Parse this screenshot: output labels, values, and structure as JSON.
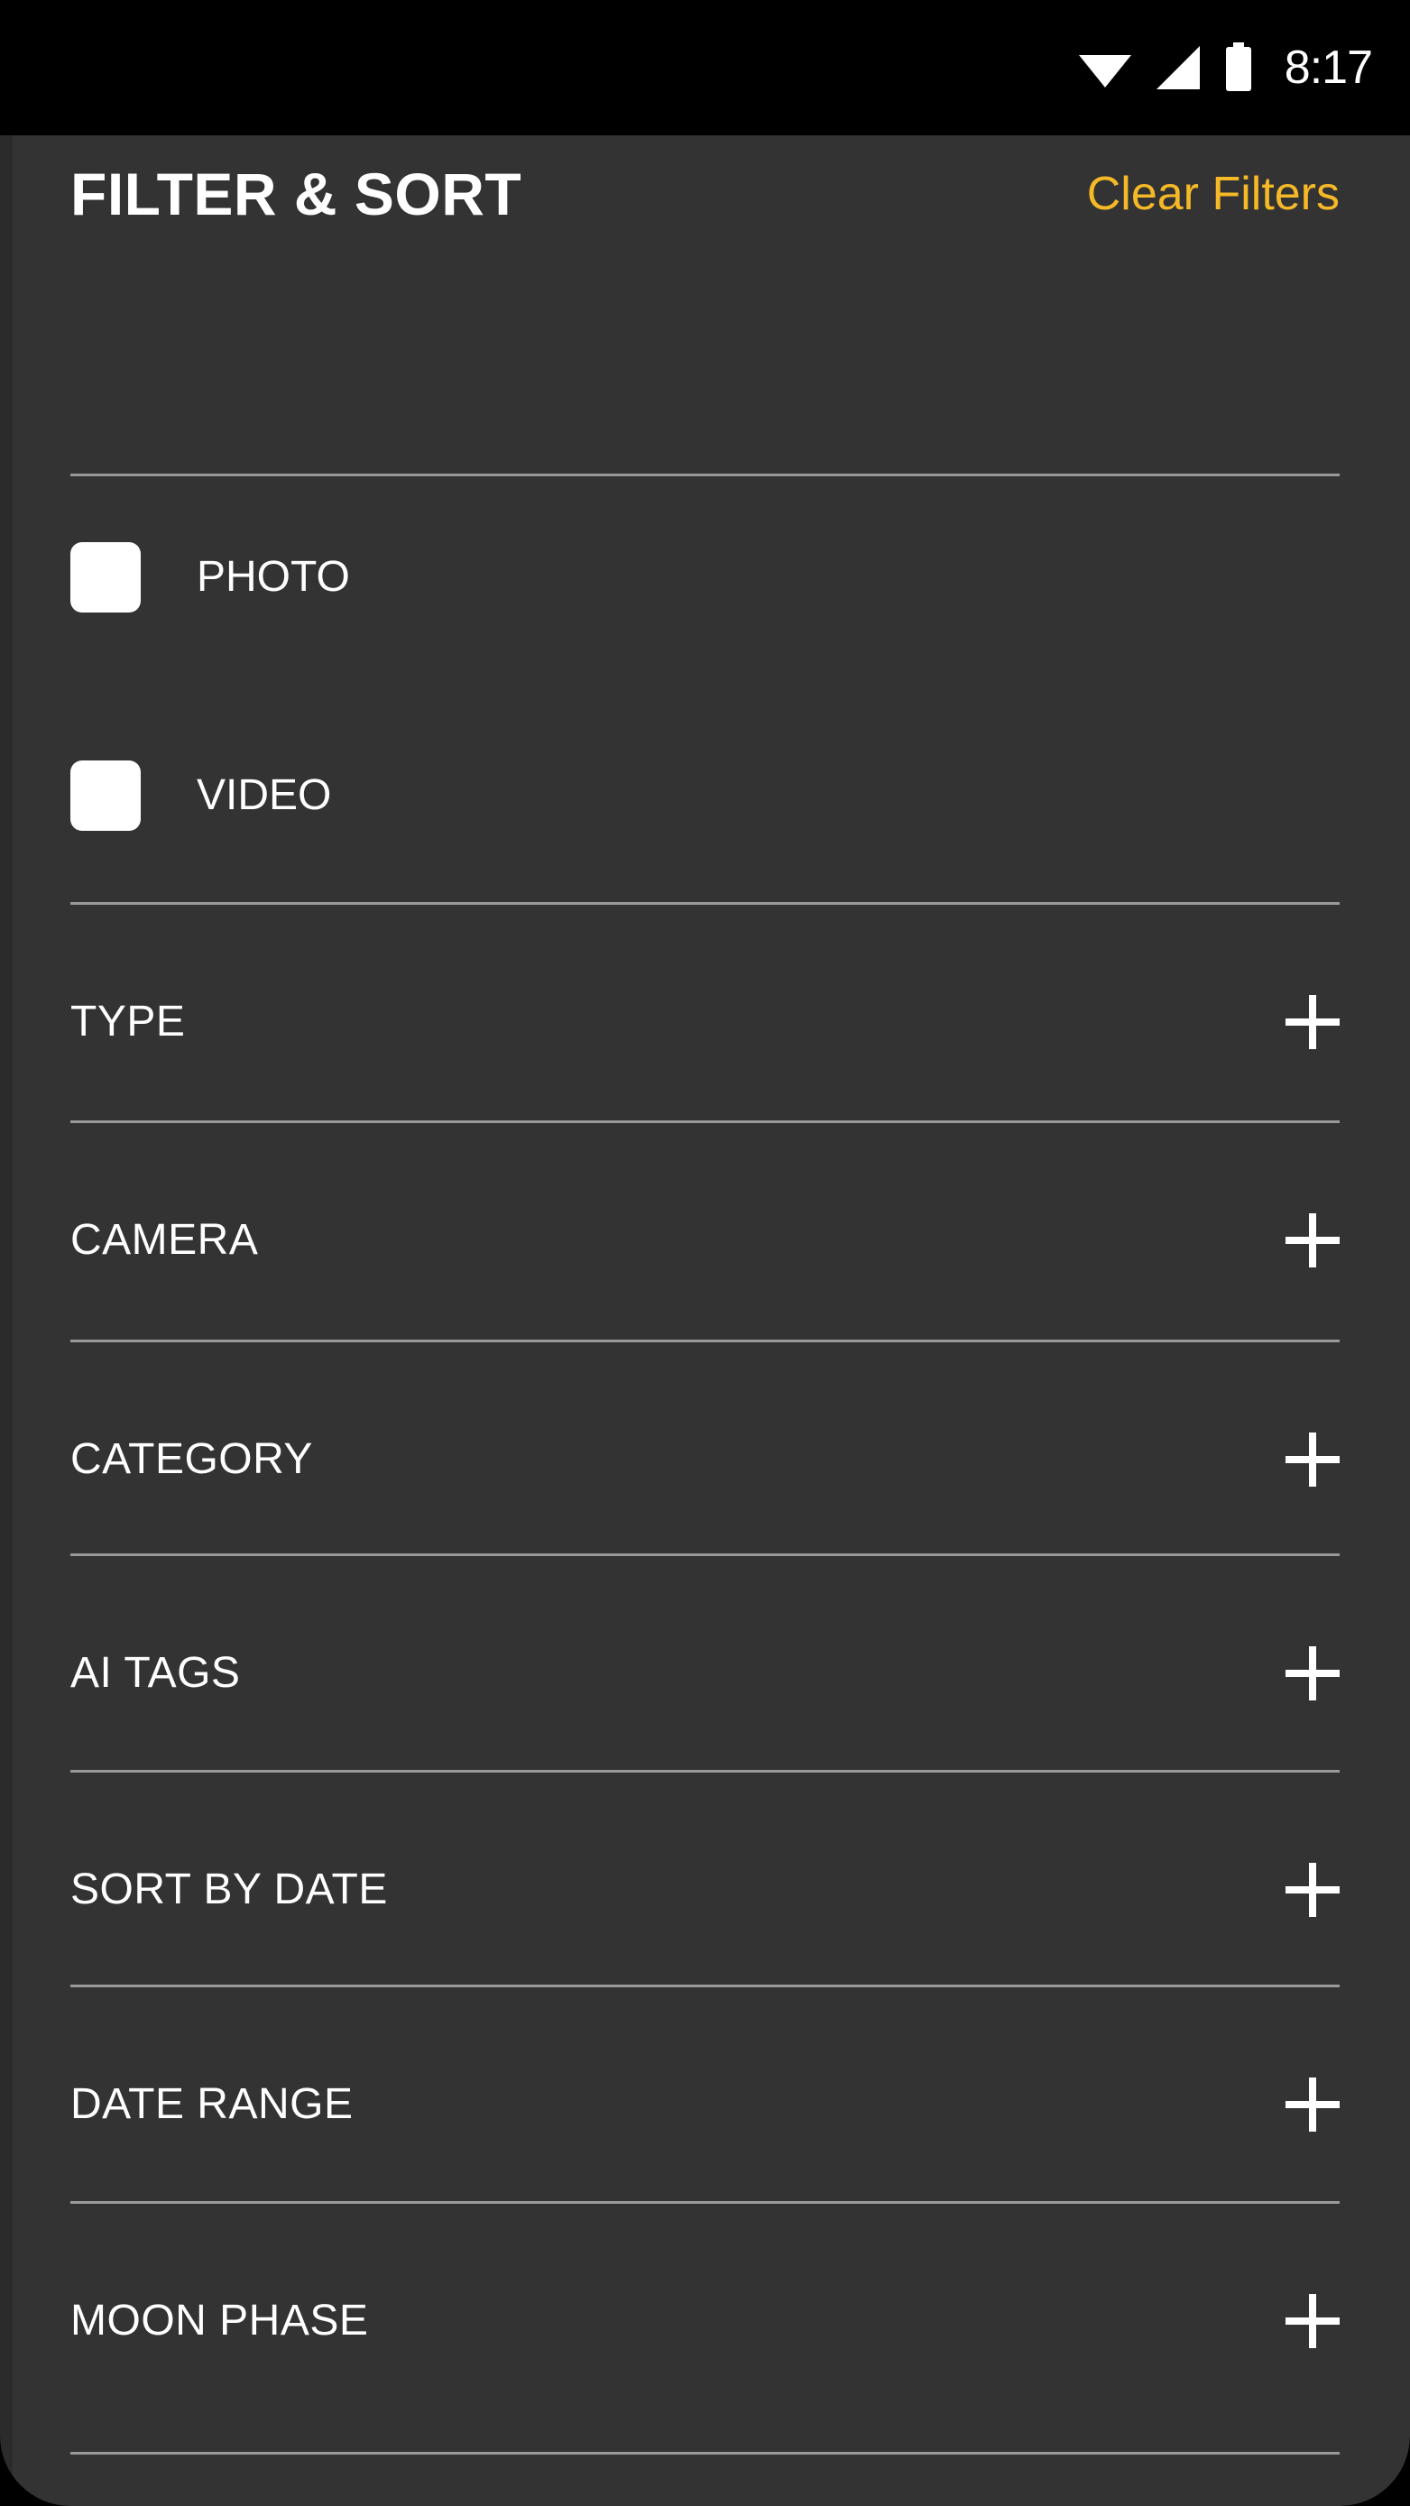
{
  "status_bar": {
    "time": "8:17",
    "icons": [
      "wifi-icon",
      "cellular-signal-icon",
      "battery-icon"
    ]
  },
  "panel": {
    "title": "FILTER & SORT",
    "clear_filters_label": "Clear Filters",
    "accent_color": "#f5b827",
    "background_color": "#333333",
    "divider_color": "#9a9a9a",
    "text_color": "#ffffff"
  },
  "media_type_filters": [
    {
      "label": "PHOTO",
      "checked": false
    },
    {
      "label": "VIDEO",
      "checked": false
    }
  ],
  "sections": [
    {
      "label": "TYPE",
      "expand_icon": "plus-icon",
      "expanded": false
    },
    {
      "label": "CAMERA",
      "expand_icon": "plus-icon",
      "expanded": false
    },
    {
      "label": "CATEGORY",
      "expand_icon": "plus-icon",
      "expanded": false
    },
    {
      "label": "AI TAGS",
      "expand_icon": "plus-icon",
      "expanded": false
    },
    {
      "label": "SORT BY DATE",
      "expand_icon": "plus-icon",
      "expanded": false
    },
    {
      "label": "DATE RANGE",
      "expand_icon": "plus-icon",
      "expanded": false
    },
    {
      "label": "MOON PHASE",
      "expand_icon": "plus-icon",
      "expanded": false
    }
  ]
}
